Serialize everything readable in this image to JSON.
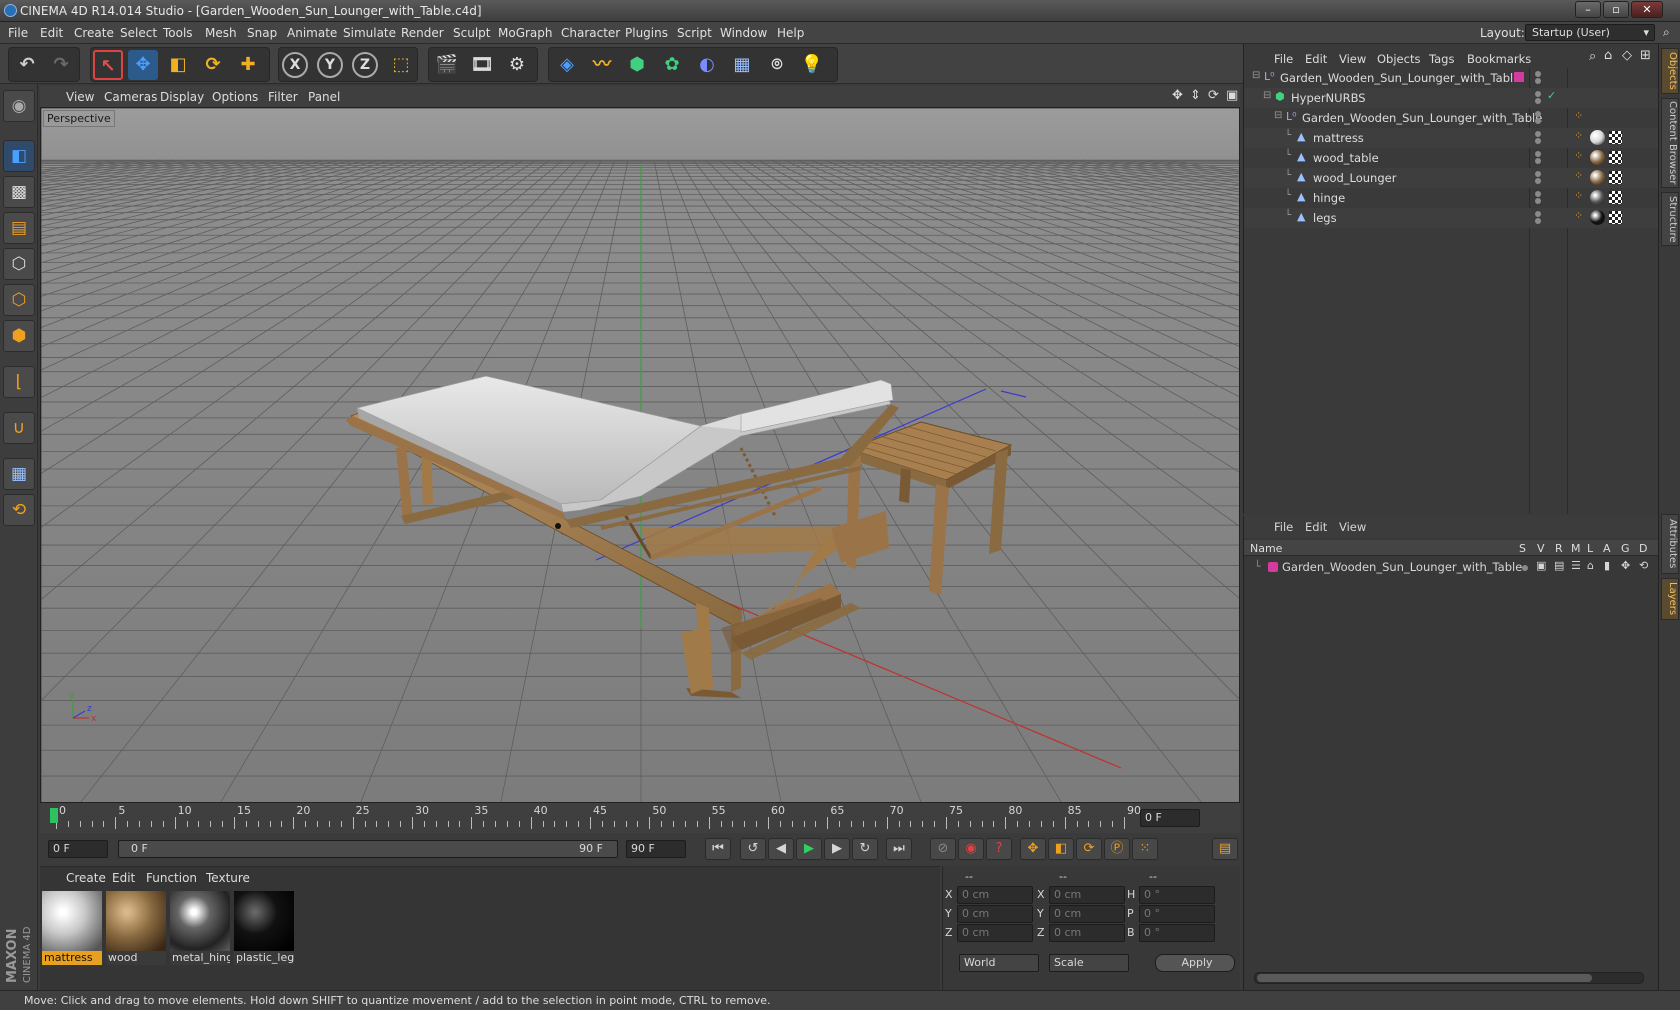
{
  "window": {
    "title": "CINEMA 4D R14.014 Studio - [Garden_Wooden_Sun_Lounger_with_Table.c4d]"
  },
  "menubar": {
    "items": [
      "File",
      "Edit",
      "Create",
      "Select",
      "Tools",
      "Mesh",
      "Snap",
      "Animate",
      "Simulate",
      "Render",
      "Sculpt",
      "MoGraph",
      "Character",
      "Plugins",
      "Script",
      "Window",
      "Help"
    ],
    "layout_label": "Layout:",
    "layout_value": "Startup (User)"
  },
  "toolbar": {
    "axis_x": "X",
    "axis_y": "Y",
    "axis_z": "Z"
  },
  "viewport": {
    "menu": [
      "View",
      "Cameras",
      "Display",
      "Options",
      "Filter",
      "Panel"
    ],
    "label": "Perspective",
    "axis_x": "x",
    "axis_y": "y",
    "axis_z": "z"
  },
  "timeline": {
    "ticks": [
      "0",
      "5",
      "10",
      "15",
      "20",
      "25",
      "30",
      "35",
      "40",
      "45",
      "50",
      "55",
      "60",
      "65",
      "70",
      "75",
      "80",
      "85",
      "90"
    ],
    "current_frame": "0 F",
    "start_frame": "0 F",
    "range_start": "0 F",
    "range_end": "90 F",
    "end_frame": "90 F"
  },
  "materials": {
    "menu": [
      "Create",
      "Edit",
      "Function",
      "Texture"
    ],
    "items": [
      {
        "name": "mattress",
        "selected": true
      },
      {
        "name": "wood",
        "selected": false
      },
      {
        "name": "metal_hing",
        "selected": false
      },
      {
        "name": "plastic_legs",
        "selected": false
      }
    ]
  },
  "coords": {
    "col1": "--",
    "col2": "--",
    "col3": "--",
    "rows": [
      {
        "a": "X",
        "av": "0 cm",
        "b": "X",
        "bv": "0 cm",
        "c": "H",
        "cv": "0 °"
      },
      {
        "a": "Y",
        "av": "0 cm",
        "b": "Y",
        "bv": "0 cm",
        "c": "P",
        "cv": "0 °"
      },
      {
        "a": "Z",
        "av": "0 cm",
        "b": "Z",
        "bv": "0 cm",
        "c": "B",
        "cv": "0 °"
      }
    ],
    "mode1": "World",
    "mode2": "Scale",
    "apply": "Apply"
  },
  "objects": {
    "menu": [
      "File",
      "Edit",
      "View",
      "Objects",
      "Tags",
      "Bookmarks"
    ],
    "tree": [
      {
        "name": "Garden_Wooden_Sun_Lounger_with_Table",
        "level": 0,
        "kind": "null"
      },
      {
        "name": "HyperNURBS",
        "level": 1,
        "kind": "nurbs"
      },
      {
        "name": "Garden_Wooden_Sun_Lounger_with_Table",
        "level": 2,
        "kind": "null"
      },
      {
        "name": "mattress",
        "level": 3,
        "kind": "poly",
        "mat": "#d8d8d8"
      },
      {
        "name": "wood_table",
        "level": 3,
        "kind": "poly",
        "mat": "#8a6a45"
      },
      {
        "name": "wood_Lounger",
        "level": 3,
        "kind": "poly",
        "mat": "#8a6a45"
      },
      {
        "name": "hinge",
        "level": 3,
        "kind": "poly",
        "mat": "#555555"
      },
      {
        "name": "legs",
        "level": 3,
        "kind": "poly",
        "mat": "#111111"
      }
    ]
  },
  "layers": {
    "menu": [
      "File",
      "Edit",
      "View"
    ],
    "columns": [
      "Name",
      "S",
      "V",
      "R",
      "M",
      "L",
      "A",
      "G",
      "D"
    ],
    "rows": [
      {
        "name": "Garden_Wooden_Sun_Lounger_with_Table",
        "color": "#d43aa0"
      }
    ]
  },
  "side_tabs": [
    "Objects",
    "Content Browser",
    "Structure",
    "Attributes",
    "Layers"
  ],
  "status": "Move: Click and drag to move elements. Hold down SHIFT to quantize movement / add to the selection in point mode, CTRL to remove.",
  "brand": {
    "maxon": "MAXON",
    "product": "CINEMA 4D"
  },
  "colors": {
    "accent": "#e8a020",
    "layer_pink": "#d43aa0"
  }
}
